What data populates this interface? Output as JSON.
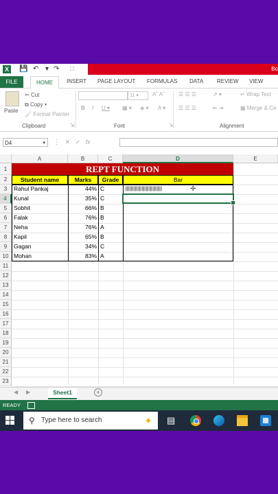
{
  "titlebar": {
    "title_partial": "Bo"
  },
  "ribbon": {
    "tabs": [
      "FILE",
      "HOME",
      "INSERT",
      "PAGE LAYOUT",
      "FORMULAS",
      "DATA",
      "REVIEW",
      "VIEW"
    ],
    "clipboard": {
      "paste": "Paste",
      "cut": "Cut",
      "copy": "Copy",
      "format_painter": "Format Painter",
      "label": "Clipboard"
    },
    "font": {
      "size": "11",
      "label": "Font"
    },
    "alignment": {
      "wrap_text": "Wrap Text",
      "merge": "Merge & Ce",
      "label": "Alignment"
    }
  },
  "formula_bar": {
    "name_box": "D4",
    "fx": "fx",
    "value": ""
  },
  "columns": [
    "A",
    "B",
    "C",
    "D",
    "E"
  ],
  "rows": [
    "1",
    "2",
    "3",
    "4",
    "5",
    "6",
    "7",
    "8",
    "9",
    "10",
    "11",
    "12",
    "13",
    "14",
    "15",
    "16",
    "17",
    "18",
    "19",
    "20",
    "21",
    "22",
    "23"
  ],
  "sheet": {
    "title": "REPT FUNCTION",
    "headers": [
      "Student name",
      "Marks",
      "Grade",
      "Bar"
    ],
    "students": [
      {
        "name": "Rahul Pankaj",
        "marks": "44%",
        "grade": "C",
        "bar": "||||||||||||||||||||||||||||||||||||||||||||"
      },
      {
        "name": "Kunal",
        "marks": "35%",
        "grade": "C",
        "bar": ""
      },
      {
        "name": "Sobhit",
        "marks": "66%",
        "grade": "B",
        "bar": ""
      },
      {
        "name": "Falak",
        "marks": "76%",
        "grade": "B",
        "bar": ""
      },
      {
        "name": "Neha",
        "marks": "76%",
        "grade": "A",
        "bar": ""
      },
      {
        "name": "Kapil",
        "marks": "65%",
        "grade": "B",
        "bar": ""
      },
      {
        "name": "Gagan",
        "marks": "34%",
        "grade": "C",
        "bar": ""
      },
      {
        "name": "Mohan",
        "marks": "83%",
        "grade": "A",
        "bar": ""
      }
    ]
  },
  "sheet_tabs": [
    "Sheet1"
  ],
  "status": {
    "ready": "READY"
  },
  "taskbar": {
    "search_placeholder": "Type here to search"
  },
  "colors": {
    "excel_green": "#217346",
    "title_red": "#c00000",
    "header_yellow": "#ffff00",
    "outer_purple": "#5a0aa8"
  }
}
